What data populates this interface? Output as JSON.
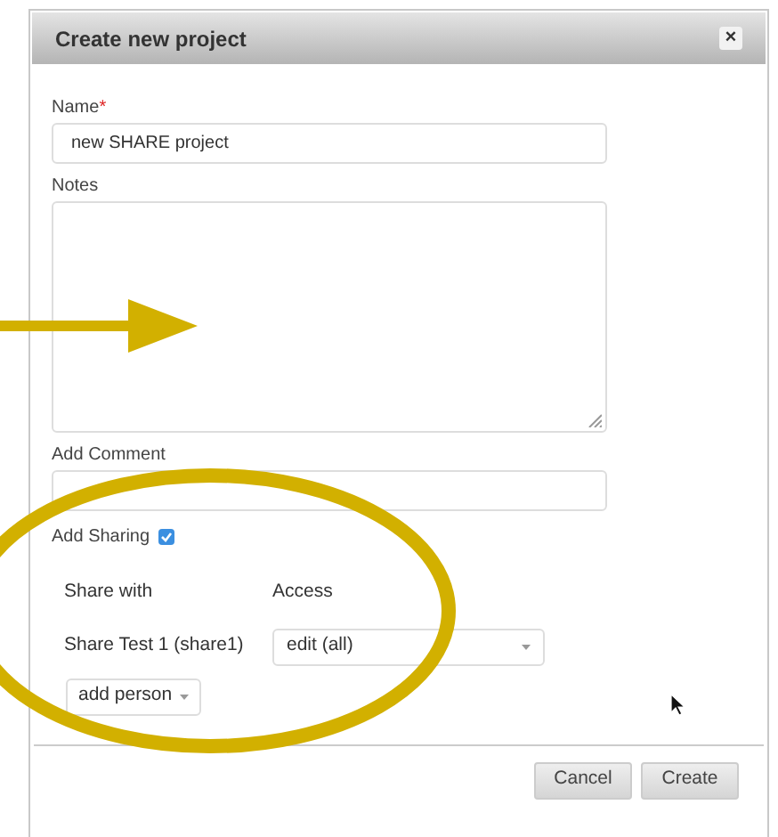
{
  "dialog": {
    "title": "Create new project",
    "close": "×"
  },
  "fields": [
    {
      "kind": "input",
      "label": "Name",
      "required_mark": "*",
      "value": "new SHARE project"
    },
    {
      "kind": "textarea",
      "label": "Notes"
    },
    {
      "kind": "input",
      "label": "Add Comment"
    }
  ],
  "sharing": {
    "label": "Add Sharing",
    "checked": true,
    "columns": [
      "Share with",
      "Access"
    ],
    "rows": [
      {
        "person": "Share Test 1 (share1)",
        "access": "edit (all)"
      }
    ],
    "add_button": "add person"
  },
  "buttons": [
    {
      "label": "Cancel"
    },
    {
      "label": "Create"
    }
  ]
}
